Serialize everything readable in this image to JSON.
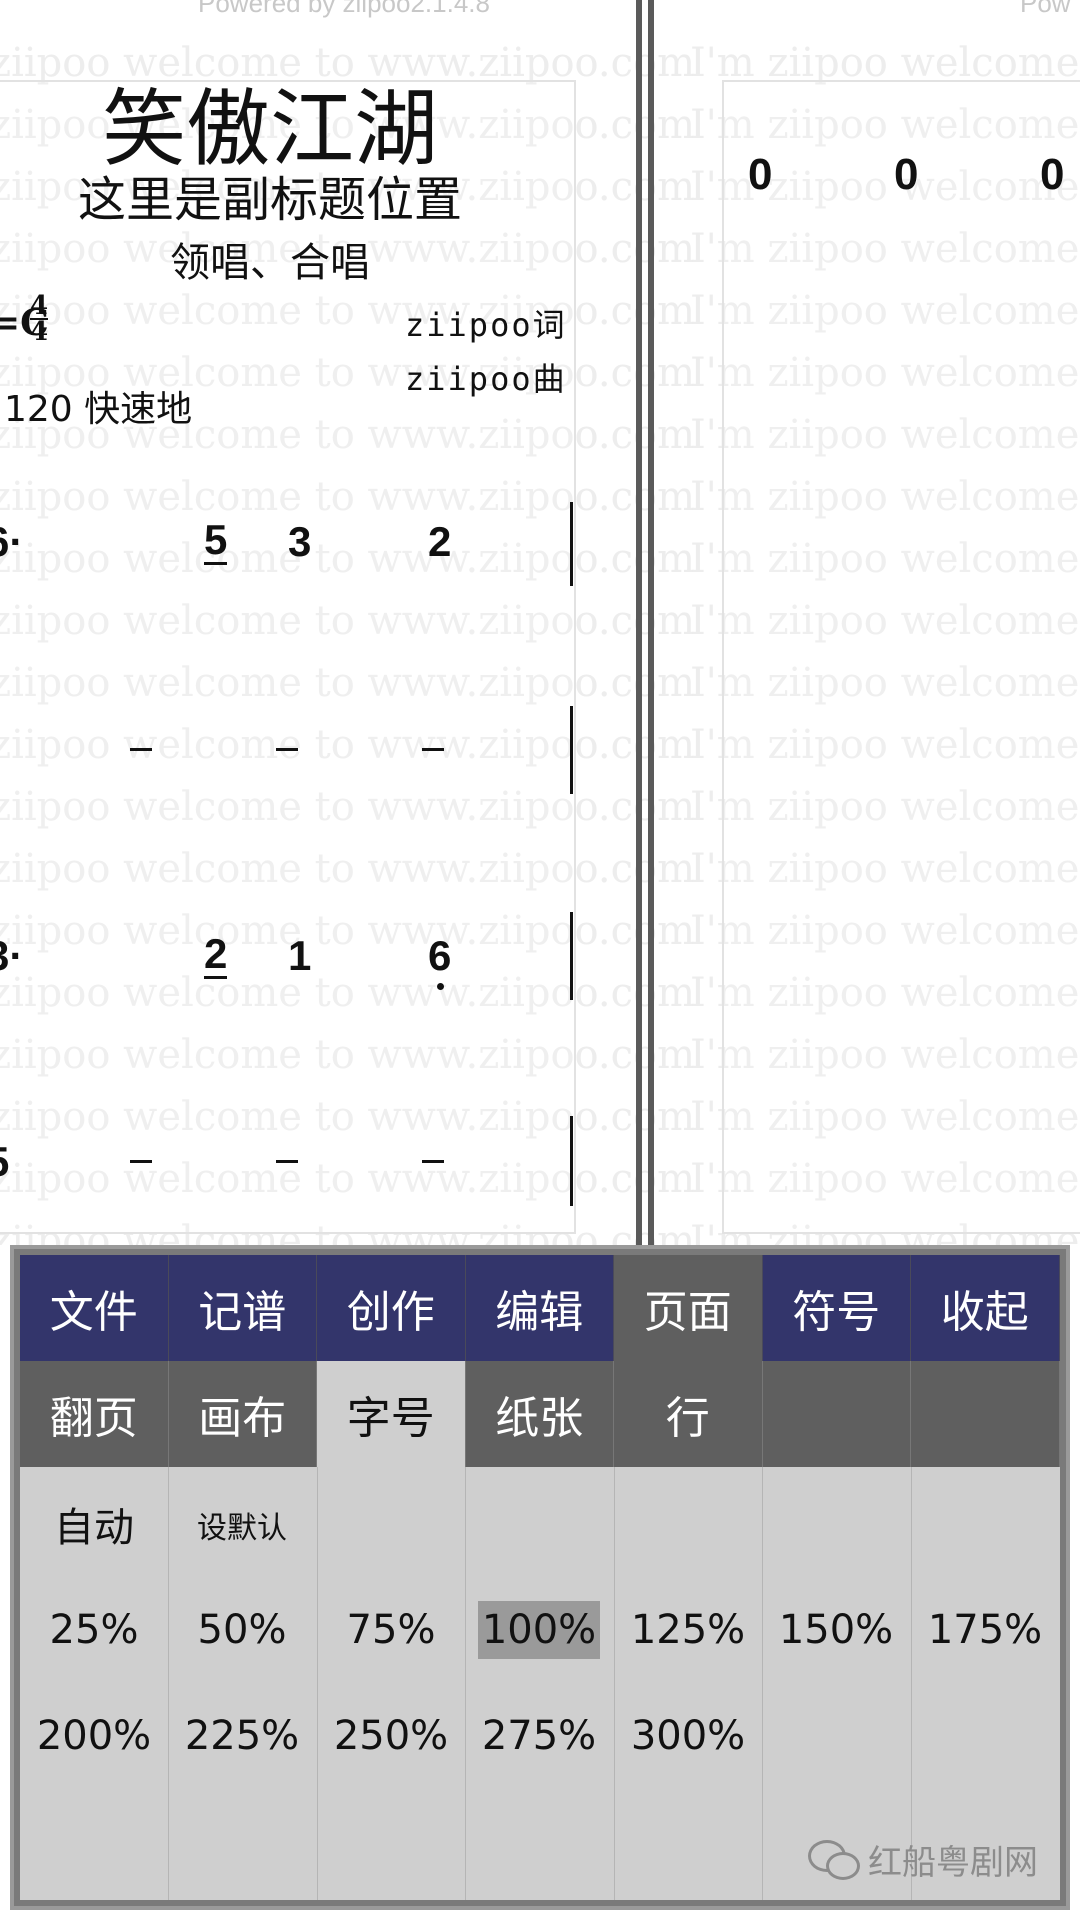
{
  "top_bar": {
    "powered_by": "Powered by ziipoo2.1.4.8",
    "powered_by_right": "Pow"
  },
  "watermark": {
    "left_text": "ziipoo  welcome to www.ziipoo.com",
    "right_text": "I'm ziipoo  welcome to w"
  },
  "score": {
    "title": "笑傲江湖",
    "subtitle": "这里是副标题位置",
    "singer": "领唱、合唱",
    "key": "=C",
    "time_top": "4",
    "time_bottom": "4",
    "lyricist": "ziipoo词",
    "composer": "ziipoo曲",
    "tempo": "120 快速地",
    "row1": [
      "6·",
      "5",
      "3",
      "2"
    ],
    "row3": [
      "3·",
      "2",
      "1",
      "6"
    ],
    "row4": [
      "5"
    ],
    "right_zeros": [
      "0",
      "0",
      "0"
    ]
  },
  "menu": {
    "tabs": [
      "文件",
      "记谱",
      "创作",
      "编辑",
      "页面",
      "符号",
      "收起"
    ],
    "subtabs": [
      "翻页",
      "画布",
      "字号",
      "纸张",
      "行"
    ],
    "options_row1": [
      "自动",
      "设默认"
    ],
    "options_row2": [
      "25%",
      "50%",
      "75%",
      "100%",
      "125%",
      "150%",
      "175%"
    ],
    "options_row3": [
      "200%",
      "225%",
      "250%",
      "275%",
      "300%"
    ],
    "selected": "100%"
  },
  "credit": {
    "text": "红船粤剧网",
    "icon": "wechat-icon"
  },
  "colors": {
    "tab_bg": "#33356b",
    "active_bg": "#5f5f5f",
    "panel_bg": "#cfcfcf"
  }
}
